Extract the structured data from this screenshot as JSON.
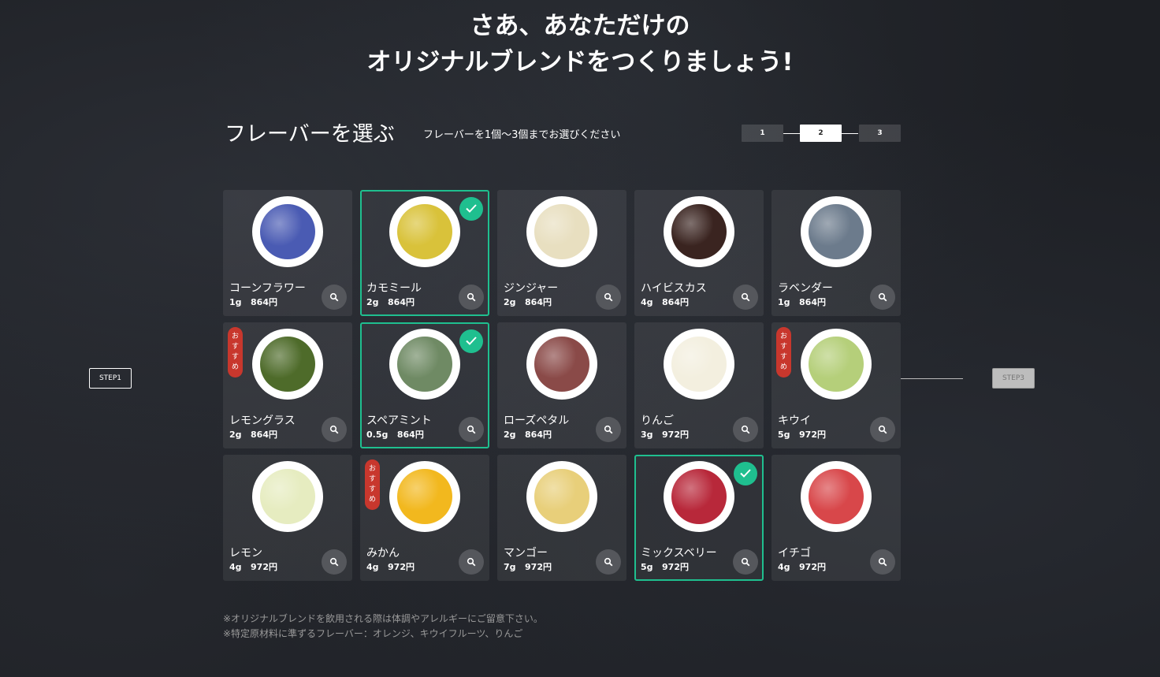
{
  "headline": {
    "line1": "さあ、あなただけの",
    "line2": "オリジナルブレンドをつくりましょう!"
  },
  "section": {
    "title": "フレーバーを選ぶ",
    "subtitle": "フレーバーを1個～3個までお選びください"
  },
  "steps": [
    {
      "label": "1",
      "active": false
    },
    {
      "label": "2",
      "active": true
    },
    {
      "label": "3",
      "active": false
    }
  ],
  "nav": {
    "prev_label": "STEP1",
    "next_label": "STEP3"
  },
  "badge_text": [
    "お",
    "す",
    "す",
    "め"
  ],
  "flavors": [
    {
      "name": "コーンフラワー",
      "amount": "1g",
      "price": "864円",
      "selected": false,
      "recommended": false,
      "color": "#4a5bb3"
    },
    {
      "name": "カモミール",
      "amount": "2g",
      "price": "864円",
      "selected": true,
      "recommended": false,
      "color": "#d9c23a"
    },
    {
      "name": "ジンジャー",
      "amount": "2g",
      "price": "864円",
      "selected": false,
      "recommended": false,
      "color": "#e8dfc0"
    },
    {
      "name": "ハイビスカス",
      "amount": "4g",
      "price": "864円",
      "selected": false,
      "recommended": false,
      "color": "#3a2420"
    },
    {
      "name": "ラベンダー",
      "amount": "1g",
      "price": "864円",
      "selected": false,
      "recommended": false,
      "color": "#6c7b8c"
    },
    {
      "name": "レモングラス",
      "amount": "2g",
      "price": "864円",
      "selected": false,
      "recommended": true,
      "color": "#4e6b2a"
    },
    {
      "name": "スペアミント",
      "amount": "0.5g",
      "price": "864円",
      "selected": true,
      "recommended": false,
      "color": "#6f8a64"
    },
    {
      "name": "ローズペタル",
      "amount": "2g",
      "price": "864円",
      "selected": false,
      "recommended": false,
      "color": "#8a4a48"
    },
    {
      "name": "りんご",
      "amount": "3g",
      "price": "972円",
      "selected": false,
      "recommended": false,
      "color": "#f3efdf"
    },
    {
      "name": "キウイ",
      "amount": "5g",
      "price": "972円",
      "selected": false,
      "recommended": true,
      "color": "#b5cf7a"
    },
    {
      "name": "レモン",
      "amount": "4g",
      "price": "972円",
      "selected": false,
      "recommended": false,
      "color": "#e6ecc0"
    },
    {
      "name": "みかん",
      "amount": "4g",
      "price": "972円",
      "selected": false,
      "recommended": true,
      "color": "#f2b81e"
    },
    {
      "name": "マンゴー",
      "amount": "7g",
      "price": "972円",
      "selected": false,
      "recommended": false,
      "color": "#e8cf7a"
    },
    {
      "name": "ミックスベリー",
      "amount": "5g",
      "price": "972円",
      "selected": true,
      "recommended": false,
      "color": "#b8283a"
    },
    {
      "name": "イチゴ",
      "amount": "4g",
      "price": "972円",
      "selected": false,
      "recommended": false,
      "color": "#d8474a"
    }
  ],
  "notes": [
    "※オリジナルブレンドを飲用される際は体調やアレルギーにご留意下さい。",
    "※特定原材料に準ずるフレーバー：オレンジ、キウイフルーツ、りんご"
  ],
  "colors": {
    "accent": "#1fbf8f",
    "badge": "#c8372d",
    "background": "#1d1f24"
  }
}
